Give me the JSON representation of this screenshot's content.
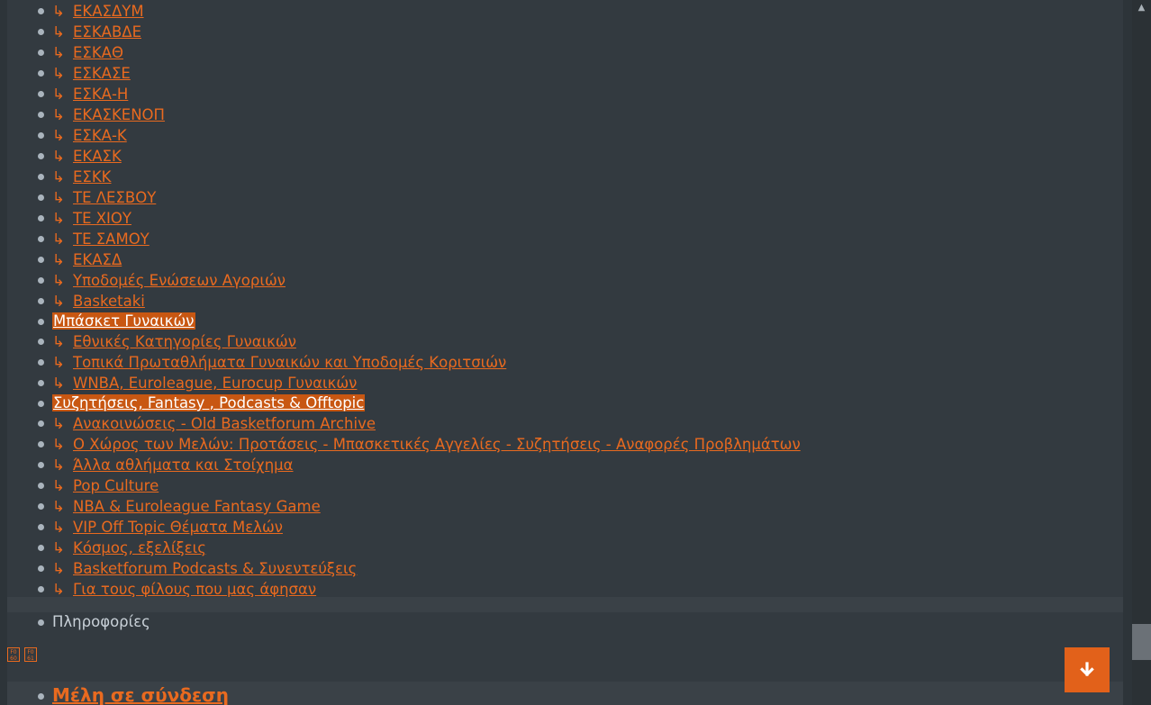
{
  "forums": {
    "items": [
      {
        "type": "sub",
        "arrow": "↳",
        "label": "ΕΚΑΣΔΥΜ"
      },
      {
        "type": "sub",
        "arrow": "↳",
        "label": "ΕΣΚΑΒΔΕ"
      },
      {
        "type": "sub",
        "arrow": "↳",
        "label": "ΕΣΚΑΘ"
      },
      {
        "type": "sub",
        "arrow": "↳",
        "label": "ΕΣΚΑΣΕ"
      },
      {
        "type": "sub",
        "arrow": "↳",
        "label": "ΕΣΚΑ-Η"
      },
      {
        "type": "sub",
        "arrow": "↳",
        "label": "ΕΚΑΣΚΕΝΟΠ"
      },
      {
        "type": "sub",
        "arrow": "↳",
        "label": "ΕΣΚΑ-Κ"
      },
      {
        "type": "sub",
        "arrow": "↳",
        "label": "ΕΚΑΣΚ"
      },
      {
        "type": "sub",
        "arrow": "↳",
        "label": "ΕΣΚΚ"
      },
      {
        "type": "sub",
        "arrow": "↳",
        "label": "ΤΕ ΛΕΣΒΟΥ"
      },
      {
        "type": "sub",
        "arrow": "↳",
        "label": "ΤΕ ΧΙΟΥ"
      },
      {
        "type": "sub",
        "arrow": "↳",
        "label": "ΤΕ ΣΑΜΟΥ"
      },
      {
        "type": "sub",
        "arrow": "↳",
        "label": "ΕΚΑΣΔ"
      },
      {
        "type": "sub",
        "arrow": "↳",
        "label": "Υποδομές Ενώσεων Αγοριών"
      },
      {
        "type": "sub",
        "arrow": "↳",
        "label": "Basketaki"
      },
      {
        "type": "cat",
        "label": "Μπάσκετ Γυναικών"
      },
      {
        "type": "sub",
        "arrow": "↳",
        "label": "Εθνικές Κατηγορίες Γυναικών"
      },
      {
        "type": "sub",
        "arrow": "↳",
        "label": "Τοπικά Πρωταθλήματα Γυναικών και Υποδομές Κοριτσιών"
      },
      {
        "type": "sub",
        "arrow": "↳",
        "label": "WNBA, Euroleague, Eurocup Γυναικών"
      },
      {
        "type": "cat",
        "label": "Συζητήσεις, Fantasy , Podcasts & Offtopic"
      },
      {
        "type": "sub",
        "arrow": "↳",
        "label": "Ανακοινώσεις - Old Basketforum Archive"
      },
      {
        "type": "sub",
        "arrow": "↳",
        "label": "Ο Χώρος των Μελών: Προτάσεις - Μπασκετικές Αγγελίες - Συζητήσεις - Αναφορές Προβλημάτων"
      },
      {
        "type": "sub",
        "arrow": "↳",
        "label": "Άλλα αθλήματα και Στοίχημα"
      },
      {
        "type": "sub",
        "arrow": "↳",
        "label": "Pop Culture"
      },
      {
        "type": "sub",
        "arrow": "↳",
        "label": "NBA & Euroleague Fantasy Game"
      },
      {
        "type": "sub",
        "arrow": "↳",
        "label": "VIP Off Topic Θέματα Μελών"
      },
      {
        "type": "sub",
        "arrow": "↳",
        "label": "Κόσμος, εξελίξεις"
      },
      {
        "type": "sub",
        "arrow": "↳",
        "label": "Basketforum Podcasts & Συνεντεύξεις"
      },
      {
        "type": "sub",
        "arrow": "↳",
        "label": "Για τους φίλους που μας άφησαν"
      }
    ]
  },
  "info": {
    "label": "Πληροφορίες"
  },
  "flags": [
    {
      "icon": "broken-image-icon",
      "code_top": "F0",
      "code_bottom": "60"
    },
    {
      "icon": "broken-image-icon",
      "code_top": "F0",
      "code_bottom": "61"
    }
  ],
  "online": {
    "title": "Μέλη σε σύνδεση"
  },
  "scroll_to_bottom": {
    "icon": "arrow-down-icon"
  },
  "scrollbar": {
    "icon": "triangle-up-icon",
    "glyph": "▲"
  },
  "colors": {
    "background": "#333a40",
    "accent": "#e96a1f",
    "category_highlight": "#c85712",
    "fab": "#e2611a"
  }
}
